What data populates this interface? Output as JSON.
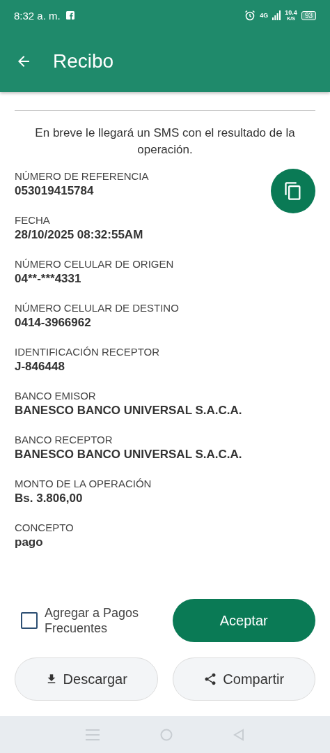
{
  "status_bar": {
    "time": "8:32 a. m.",
    "network": "4G",
    "speed": "10.4",
    "speed_unit": "K/S",
    "battery": "93"
  },
  "header": {
    "title": "Recibo"
  },
  "message": "En breve le llegará un SMS con el resultado de la operación.",
  "fields": [
    {
      "label": "NÚMERO DE REFERENCIA",
      "value": "053019415784"
    },
    {
      "label": "FECHA",
      "value": "28/10/2025 08:32:55AM"
    },
    {
      "label": "NÚMERO CELULAR DE ORIGEN",
      "value": "04**-***4331"
    },
    {
      "label": "NÚMERO CELULAR DE DESTINO",
      "value": "0414-3966962"
    },
    {
      "label": "IDENTIFICACIÓN RECEPTOR",
      "value": "J-846448"
    },
    {
      "label": "BANCO EMISOR",
      "value": "BANESCO BANCO UNIVERSAL S.A.C.A."
    },
    {
      "label": "BANCO RECEPTOR",
      "value": "BANESCO BANCO UNIVERSAL S.A.C.A."
    },
    {
      "label": "MONTO DE LA OPERACIÓN",
      "value": "Bs. 3.806,00"
    },
    {
      "label": "CONCEPTO",
      "value": "pago"
    }
  ],
  "frequent_checkbox": {
    "label": "Agregar a Pagos Frecuentes",
    "checked": false
  },
  "buttons": [
    {
      "label": "Aceptar",
      "kind": "primary"
    },
    {
      "label": "Descargar",
      "kind": "download"
    },
    {
      "label": "Compartir",
      "kind": "share"
    }
  ]
}
